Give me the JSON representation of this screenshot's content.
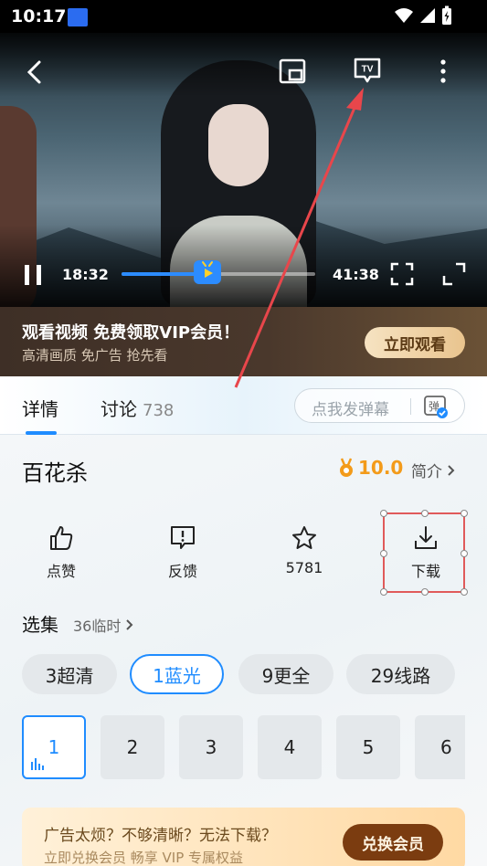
{
  "status_bar": {
    "time": "10:17"
  },
  "player": {
    "current_time": "18:32",
    "duration": "41:38",
    "progress": 0.445
  },
  "promo": {
    "title": "观看视频 免费领取VIP会员！",
    "subtitle": "高清画质 免广告 抢先看",
    "button": "立即观看"
  },
  "tabs": {
    "detail": "详情",
    "discuss": "讨论",
    "discuss_count": "738",
    "danmaku_placeholder": "点我发弹幕"
  },
  "show": {
    "title": "百花杀",
    "score": "10.0",
    "intro_label": "简介"
  },
  "actions": {
    "like": "点赞",
    "feedback": "反馈",
    "favorite_count": "5781",
    "download": "下载"
  },
  "episodes": {
    "heading": "选集",
    "sub": "36临时",
    "sources": [
      "3超清",
      "1蓝光",
      "9更全",
      "29线路"
    ],
    "active_source": 1,
    "items": [
      "1",
      "2",
      "3",
      "4",
      "5",
      "6"
    ],
    "active_item": 0
  },
  "bottom_promo": {
    "line1": "广告太烦？不够清晰？无法下载？",
    "line2": "立即兑换会员 畅享 VIP 专属权益",
    "button": "兑换会员"
  },
  "colors": {
    "accent": "#1f8cff",
    "score": "#f39b1a",
    "annotation": "#e05a5a"
  }
}
